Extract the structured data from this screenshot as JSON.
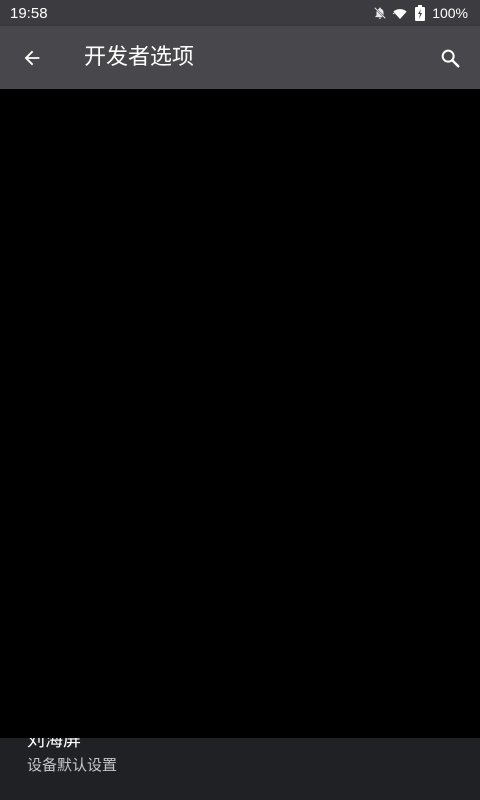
{
  "status_bar": {
    "time": "19:58",
    "battery": "100%",
    "icons": [
      "notifications-off-icon",
      "wifi-icon",
      "battery-charging-icon"
    ]
  },
  "app_bar": {
    "title": "开发者选项",
    "back_icon": "arrow-back-icon",
    "search_icon": "search-icon"
  },
  "setting": {
    "title": "刘海屏",
    "summary": "设备默认设置"
  },
  "colors": {
    "status_bar_bg": "#3c3c40",
    "app_bar_bg": "#48484c",
    "page_bg": "#202124",
    "overlay": "#000000"
  }
}
